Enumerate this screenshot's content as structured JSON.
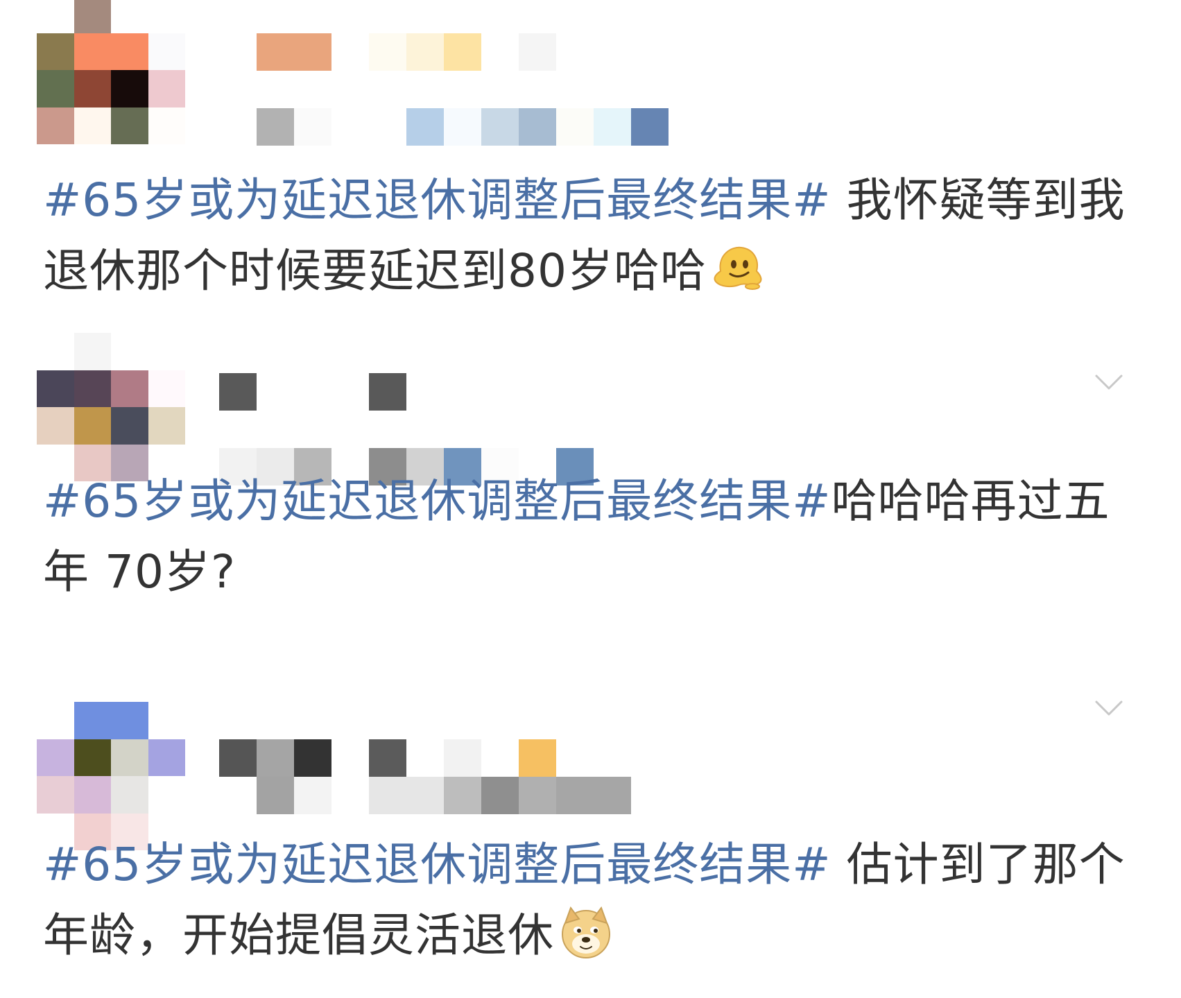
{
  "posts": [
    {
      "hashtag": "#65岁或为延迟退休调整后最终结果#",
      "text": " 我怀疑等到我退休那个时候要延迟到80岁哈哈",
      "emoji": "melting-face-icon",
      "avatar_colors": [
        "#ffffff",
        "#a48a7e",
        "#ffffff",
        "#ffffff",
        "#8a7a4e",
        "#f98b63",
        "#f98b63",
        "#fafafc",
        "#627050",
        "#8e4634",
        "#170b0a",
        "#eec9cf",
        "#cb998c",
        "#fff7ee",
        "#666d54",
        "#fffdfb"
      ],
      "meta_rows": [
        [
          "#ffffff",
          "#e9a57d",
          "#e9a57d",
          "#ffffff",
          "#fefbf1",
          "#fdf3d9",
          "#fde3a3",
          "#ffffff",
          "#f5f5f5"
        ],
        [
          "#ffffff",
          "#ffffff",
          "#ffffff",
          "#ffffff",
          "#ffffff",
          "#ffffff",
          "#ffffff",
          "#ffffff",
          "#ffffff"
        ],
        [
          "#ffffff",
          "#b2b2b2",
          "#fafafa",
          "#ffffff",
          "#ffffff",
          "#b6cfe8",
          "#f6fafe",
          "#c8d8e6",
          "#a7bcd2",
          "#fcfcf8",
          "#e5f5fa",
          "#6685b3"
        ]
      ]
    },
    {
      "hashtag": "#65岁或为延迟退休调整后最终结果#",
      "text": "哈哈哈再过五年 70岁?",
      "emoji": "",
      "avatar_colors": [
        "#ffffff",
        "#f5f5f5",
        "#ffffff",
        "#ffffff",
        "#4b4659",
        "#574556",
        "#b07b86",
        "#fff9fc",
        "#e6d0bf",
        "#c0964b",
        "#4a4d5c",
        "#e2d7bf",
        "#ffffff",
        "#e8c8c5",
        "#b8a6b6",
        "#ffffff"
      ],
      "meta_rows": [
        [
          "#595959",
          "#ffffff",
          "#ffffff",
          "#ffffff",
          "#595959"
        ],
        [
          "#ffffff",
          "#ffffff",
          "#ffffff",
          "#ffffff",
          "#ffffff"
        ],
        [
          "#f2f2f2",
          "#ebebeb",
          "#b7b7b7",
          "#ffffff",
          "#8d8d8d",
          "#d2d2d2",
          "#7094be",
          "#fcfcfc",
          "#ffffff",
          "#6a8fba"
        ]
      ]
    },
    {
      "hashtag": "#65岁或为延迟退休调整后最终结果#",
      "text": " 估计到了那个年龄，开始提倡灵活退休",
      "emoji": "doge-icon",
      "avatar_colors": [
        "#ffffff",
        "#6f8fe0",
        "#6f8fe0",
        "#ffffff",
        "#c7b3df",
        "#4d4e1e",
        "#d3d3c8",
        "#a4a3e1",
        "#e8cdd5",
        "#d7bad8",
        "#e7e6e4",
        "#ffffff",
        "#ffffff",
        "#f2d0d0",
        "#f8e6e6",
        "#ffffff"
      ],
      "meta_rows": [
        [
          "#555555",
          "#a5a5a5",
          "#333333",
          "#ffffff",
          "#5b5b5b",
          "#ffffff",
          "#f2f2f2",
          "#ffffff",
          "#f6c062"
        ],
        [
          "#ffffff",
          "#a3a3a3",
          "#f3f3f3",
          "#ffffff",
          "#e6e6e6",
          "#e6e6e6",
          "#bdbdbd",
          "#8f8f8f",
          "#b0b0b0",
          "#a6a6a6",
          "#a6a6a6"
        ]
      ]
    }
  ],
  "icons": {
    "chevron": "chevron-down-icon"
  },
  "colors": {
    "hashtag": "#4a6fa5",
    "text": "#333333",
    "chevron": "#c8c8c8"
  }
}
